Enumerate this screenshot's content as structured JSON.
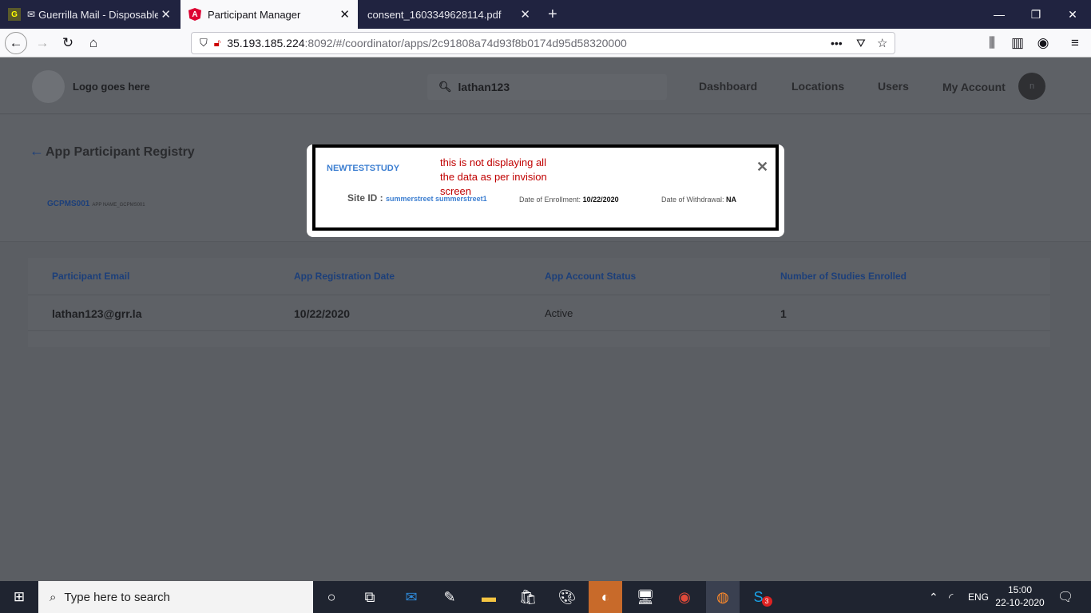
{
  "browser": {
    "tabs": [
      {
        "label": "Guerrilla Mail - Disposable T",
        "icon": "guerrilla-icon"
      },
      {
        "label": "Participant Manager",
        "icon": "angular-icon"
      },
      {
        "label": "consent_1603349628114.pdf",
        "icon": ""
      }
    ],
    "url_host": "35.193.185.224",
    "url_path": ":8092/#/coordinator/apps/2c91808a74d93f8b0174d95d58320000"
  },
  "header": {
    "logo_text": "Logo goes here",
    "search_value": "lathan123",
    "nav": [
      "Dashboard",
      "Locations",
      "Users",
      "My Account"
    ],
    "avatar_letter": "n"
  },
  "registry": {
    "back_label": "App Participant Registry",
    "app_id": "GCPMS001",
    "app_name": "APP NAME_GCPMS001"
  },
  "table": {
    "headers": [
      "Participant Email",
      "App Registration Date",
      "App Account Status",
      "Number of Studies Enrolled"
    ],
    "rows": [
      [
        "lathan123@grr.la",
        "10/22/2020",
        "Active",
        "1"
      ]
    ]
  },
  "modal": {
    "title": "NEWTESTSTUDY",
    "note": "this is not displaying all the data as per invision screen",
    "site_label": "Site ID :",
    "site_value": "summerstreet summerstreet1",
    "enroll_label": "Date of Enrollment:",
    "enroll_value": "10/22/2020",
    "withdraw_label": "Date of Withdrawal:",
    "withdraw_value": "NA"
  },
  "taskbar": {
    "search_placeholder": "Type here to search",
    "lang": "ENG",
    "time": "15:00",
    "date": "22-10-2020",
    "skype_badge": "3"
  },
  "colors": {
    "accent": "#3d7fd1",
    "note": "#c00000",
    "link_dark": "#1c3f7a"
  }
}
